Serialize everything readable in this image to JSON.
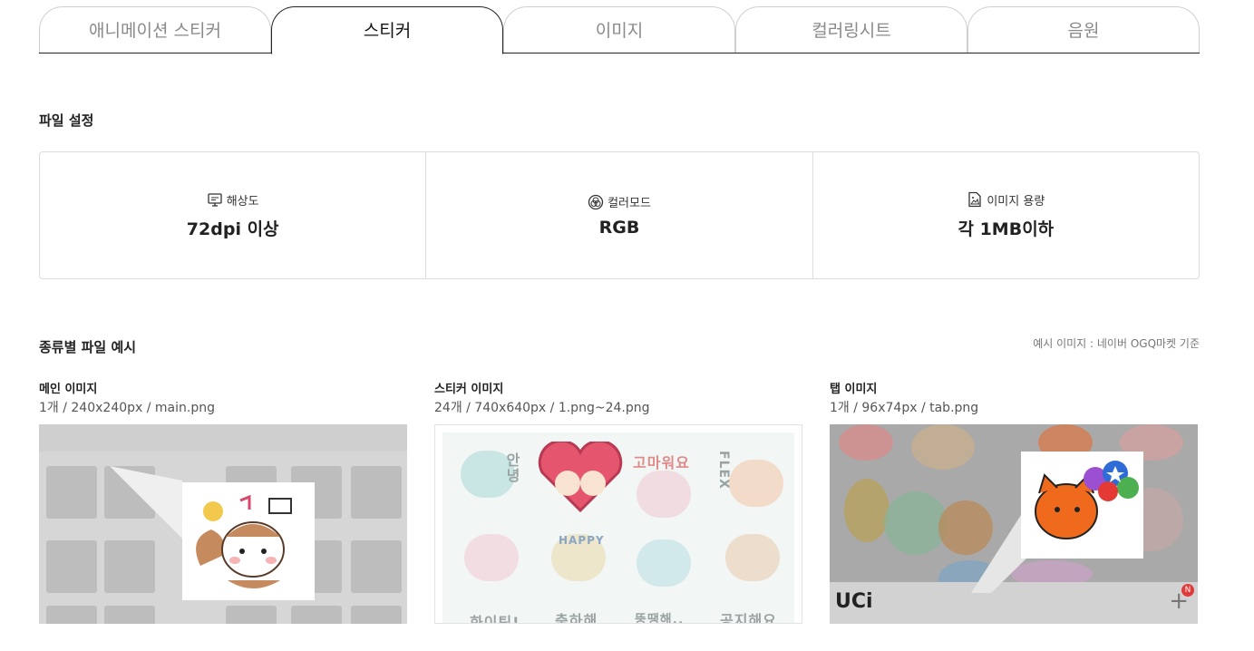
{
  "tabs": [
    {
      "label": "애니메이션 스티커",
      "active": false
    },
    {
      "label": "스티커",
      "active": true
    },
    {
      "label": "이미지",
      "active": false
    },
    {
      "label": "컬러링시트",
      "active": false
    },
    {
      "label": "음원",
      "active": false
    }
  ],
  "file_settings": {
    "title": "파일 설정",
    "items": [
      {
        "icon": "monitor-icon",
        "label": "해상도",
        "value": "72dpi 이상"
      },
      {
        "icon": "color-mode-icon",
        "label": "컬러모드",
        "value": "RGB"
      },
      {
        "icon": "image-file-icon",
        "label": "이미지 용량",
        "value": "각 1MB이하"
      }
    ]
  },
  "examples": {
    "title": "종류별 파일 예시",
    "note": "예시 이미지 : 네이버 OGQ마켓 기준",
    "items": [
      {
        "title": "메인 이미지",
        "desc": "1개 / 240x240px / main.png"
      },
      {
        "title": "스티커 이미지",
        "desc": "24개 / 740x640px / 1.png~24.png"
      },
      {
        "title": "탭 이미지",
        "desc": "1개 / 96x74px / tab.png"
      }
    ]
  },
  "sticker_words": [
    "안녕",
    "고마워요",
    "FLEX",
    "HAPPY",
    "화이팅!",
    "축하해",
    "뚱땡해..",
    "공지해요"
  ],
  "tab_thumb": {
    "logo": "UCi",
    "badge": "N",
    "plus": "+"
  },
  "colors": {
    "active_tab_border": "#222222",
    "inactive_tab_border": "#cfcfcf",
    "box_border": "#dcdcdc"
  }
}
